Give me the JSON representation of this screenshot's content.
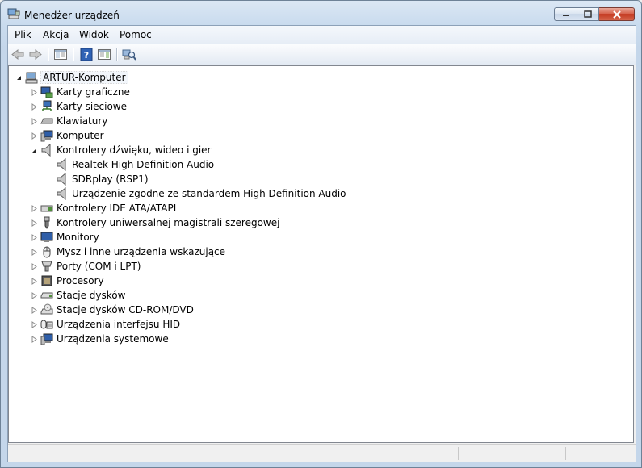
{
  "window": {
    "title": "Menedżer urządzeń",
    "controls": [
      "minimize",
      "maximize",
      "close"
    ]
  },
  "menu": {
    "items": [
      {
        "label": "Plik"
      },
      {
        "label": "Akcja"
      },
      {
        "label": "Widok"
      },
      {
        "label": "Pomoc"
      }
    ]
  },
  "toolbar": {
    "buttons": [
      "back-arrow-icon",
      "forward-arrow-icon",
      "show-hide-console-tree-icon",
      "help-icon",
      "properties-icon",
      "scan-hardware-icon"
    ]
  },
  "tree": {
    "root": {
      "label": "ARTUR-Komputer",
      "icon": "computer-icon",
      "expanded": true
    },
    "categories": [
      {
        "label": "Karty graficzne",
        "icon": "display-adapter-icon",
        "expanded": false
      },
      {
        "label": "Karty sieciowe",
        "icon": "network-adapter-icon",
        "expanded": false
      },
      {
        "label": "Klawiatury",
        "icon": "keyboard-icon",
        "expanded": false
      },
      {
        "label": "Komputer",
        "icon": "computer-monitor-icon",
        "expanded": false
      },
      {
        "label": "Kontrolery dźwięku, wideo i gier",
        "icon": "speaker-icon",
        "expanded": true,
        "children": [
          {
            "label": "Realtek High Definition Audio",
            "icon": "speaker-icon"
          },
          {
            "label": "SDRplay (RSP1)",
            "icon": "speaker-icon"
          },
          {
            "label": "Urządzenie zgodne ze standardem High Definition Audio",
            "icon": "speaker-icon"
          }
        ]
      },
      {
        "label": "Kontrolery IDE ATA/ATAPI",
        "icon": "ide-controller-icon",
        "expanded": false
      },
      {
        "label": "Kontrolery uniwersalnej magistrali szeregowej",
        "icon": "usb-icon",
        "expanded": false
      },
      {
        "label": "Monitory",
        "icon": "monitor-icon",
        "expanded": false
      },
      {
        "label": "Mysz i inne urządzenia wskazujące",
        "icon": "mouse-icon",
        "expanded": false
      },
      {
        "label": "Porty (COM i LPT)",
        "icon": "port-icon",
        "expanded": false
      },
      {
        "label": "Procesory",
        "icon": "processor-icon",
        "expanded": false
      },
      {
        "label": "Stacje dysków",
        "icon": "disk-drive-icon",
        "expanded": false
      },
      {
        "label": "Stacje dysków CD-ROM/DVD",
        "icon": "cdrom-icon",
        "expanded": false
      },
      {
        "label": "Urządzenia interfejsu HID",
        "icon": "hid-icon",
        "expanded": false
      },
      {
        "label": "Urządzenia systemowe",
        "icon": "system-device-icon",
        "expanded": false
      }
    ]
  },
  "colors": {
    "frame": "#c4d6ea",
    "close_button": "#c3381f",
    "tree_background": "#ffffff"
  }
}
